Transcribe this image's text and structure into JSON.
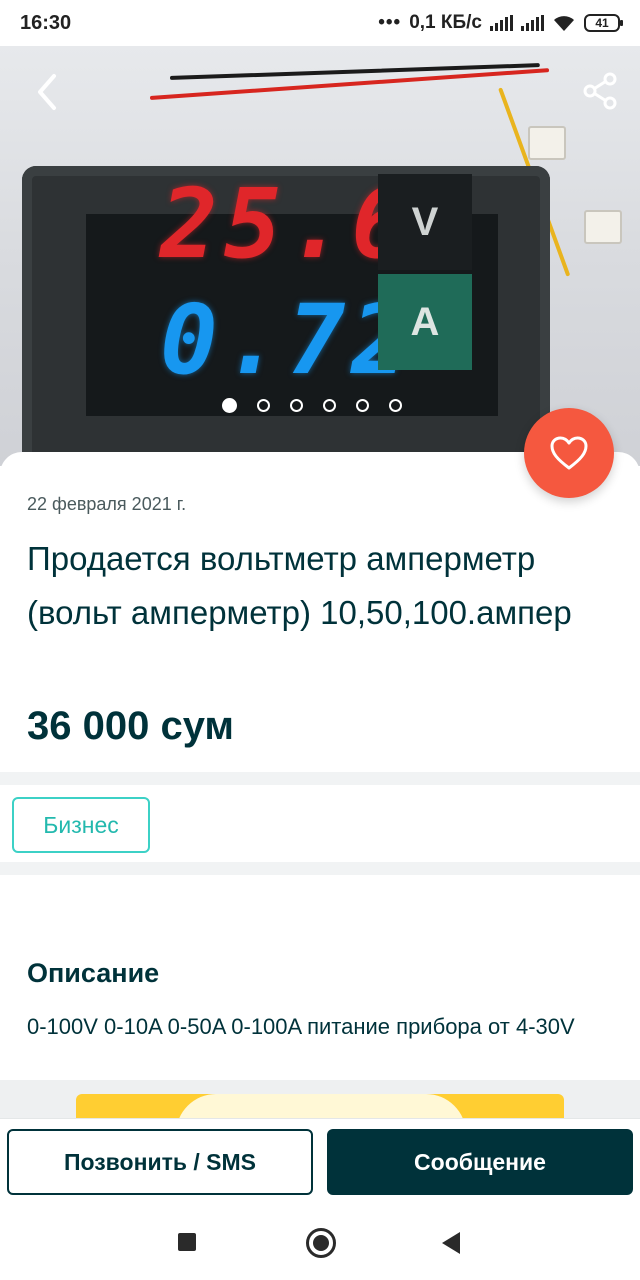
{
  "status_bar": {
    "time": "16:30",
    "dots": "•••",
    "net_speed": "0,1 КБ/с",
    "battery": "41"
  },
  "gallery": {
    "image_subject": "voltmeter-ammeter-photo",
    "reading_top": "25.6",
    "reading_bottom": "0.72",
    "unit_top": "V",
    "unit_bottom": "A",
    "slide_count": 6,
    "active_slide": 1
  },
  "ad": {
    "date": "22 февраля 2021 г.",
    "title": "Продается вольтметр амперметр (вольт амперметр) 10,50,100.ампер",
    "price": "36 000 сум",
    "badge": "Бизнес"
  },
  "description": {
    "heading": "Описание",
    "text": "0-100V 0-10A 0-50A 0-100A питание прибора от 4-30V"
  },
  "actions": {
    "call_label": "Позвонить / SMS",
    "message_label": "Сообщение"
  },
  "icons": {
    "back": "chevron-left-icon",
    "share": "share-icon",
    "favorite": "heart-icon"
  },
  "colors": {
    "primary": "#00323a",
    "favorite": "#f5583f",
    "badge": "#23b9ae",
    "promo": "#ffce32"
  }
}
